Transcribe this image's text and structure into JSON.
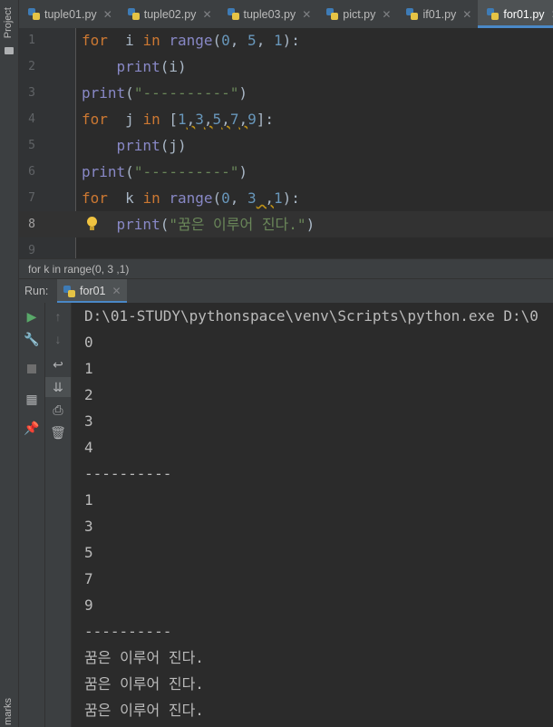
{
  "left_strip": {
    "top_label": "Project",
    "bottom_label": "marks"
  },
  "tabs": [
    {
      "label": "tuple01.py",
      "active": false
    },
    {
      "label": "tuple02.py",
      "active": false
    },
    {
      "label": "tuple03.py",
      "active": false
    },
    {
      "label": "pict.py",
      "active": false
    },
    {
      "label": "if01.py",
      "active": false
    },
    {
      "label": "for01.py",
      "active": true
    }
  ],
  "editor": {
    "current_line": 8,
    "lines": [
      {
        "n": "1",
        "tokens": [
          [
            "kw",
            "for"
          ],
          [
            "",
            "  i "
          ],
          [
            "kw",
            "in"
          ],
          [
            "",
            ""
          ],
          [
            "fn",
            " range"
          ],
          [
            "",
            "("
          ],
          [
            "num",
            "0"
          ],
          [
            "",
            ", "
          ],
          [
            "num",
            "5"
          ],
          [
            "",
            ", "
          ],
          [
            "num",
            "1"
          ],
          [
            "",
            "):"
          ]
        ]
      },
      {
        "n": "2",
        "tokens": [
          [
            "",
            "    "
          ],
          [
            "fn",
            "print"
          ],
          [
            "",
            "(i)"
          ]
        ]
      },
      {
        "n": "3",
        "tokens": [
          [
            "fn",
            "print"
          ],
          [
            "",
            "("
          ],
          [
            "str",
            "\"----------\""
          ],
          [
            "",
            ")"
          ]
        ]
      },
      {
        "n": "4",
        "tokens": [
          [
            "kw",
            "for"
          ],
          [
            "",
            "  j "
          ],
          [
            "kw",
            "in"
          ],
          [
            "",
            " ["
          ],
          [
            "num",
            "1"
          ],
          [
            "warn",
            ","
          ],
          [
            "num",
            "3"
          ],
          [
            "warn",
            ","
          ],
          [
            "num",
            "5"
          ],
          [
            "warn",
            ","
          ],
          [
            "num",
            "7"
          ],
          [
            "warn",
            ","
          ],
          [
            "num",
            "9"
          ],
          [
            "",
            "]:"
          ]
        ]
      },
      {
        "n": "5",
        "tokens": [
          [
            "",
            "    "
          ],
          [
            "fn",
            "print"
          ],
          [
            "",
            "(j)"
          ]
        ]
      },
      {
        "n": "6",
        "tokens": [
          [
            "fn",
            "print"
          ],
          [
            "",
            "("
          ],
          [
            "str",
            "\"----------\""
          ],
          [
            "",
            ")"
          ]
        ]
      },
      {
        "n": "7",
        "tokens": [
          [
            "kw",
            "for"
          ],
          [
            "",
            "  k "
          ],
          [
            "kw",
            "in"
          ],
          [
            "fn",
            " range"
          ],
          [
            "",
            "("
          ],
          [
            "num",
            "0"
          ],
          [
            "",
            ", "
          ],
          [
            "num",
            "3"
          ],
          [
            "warn",
            " ,"
          ],
          [
            "num",
            "1"
          ],
          [
            "",
            "):"
          ]
        ]
      },
      {
        "n": "8",
        "tokens": [
          [
            "",
            "    "
          ],
          [
            "fn",
            "print"
          ],
          [
            "",
            "("
          ],
          [
            "str",
            "\"꿈은 이루어 진다.\""
          ],
          [
            "",
            ")"
          ]
        ]
      },
      {
        "n": "9",
        "tokens": []
      }
    ]
  },
  "breadcrumb": "for k in range(0, 3 ,1)",
  "run": {
    "label": "Run:",
    "tab": "for01"
  },
  "console_lines": [
    "D:\\01-STUDY\\pythonspace\\venv\\Scripts\\python.exe D:\\0",
    "0",
    "1",
    "2",
    "3",
    "4",
    "----------",
    "1",
    "3",
    "5",
    "7",
    "9",
    "----------",
    "꿈은 이루어 진다.",
    "꿈은 이루어 진다.",
    "꿈은 이루어 진다."
  ],
  "icons": {
    "run": "run-icon",
    "wrench": "settings-icon",
    "stop": "stop-icon",
    "layout": "layout-icon",
    "pin": "pin-icon",
    "up": "arrow-up-icon",
    "down": "arrow-down-icon",
    "wrap": "soft-wrap-icon",
    "scroll": "scroll-to-end-icon",
    "print": "print-icon",
    "trash": "trash-icon"
  },
  "colors": {
    "keyword": "#cc7832",
    "builtin": "#8888c6",
    "number": "#6897bb",
    "string": "#6a8759",
    "accent": "#4a88c7",
    "run_green": "#59a869"
  }
}
